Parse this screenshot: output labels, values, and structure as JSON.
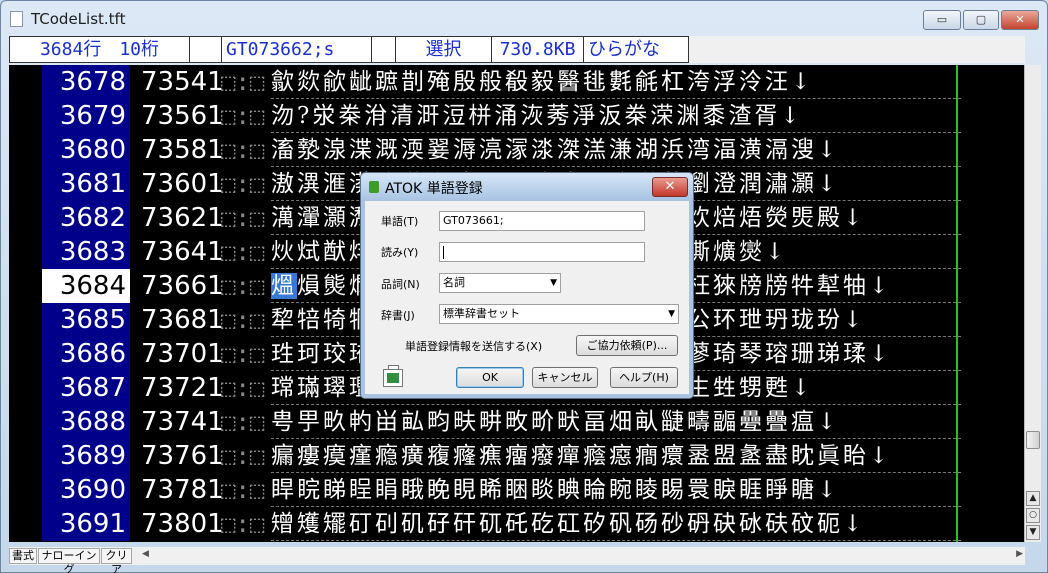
{
  "window": {
    "title": "TCodeList.tft",
    "min_label": "▭",
    "max_label": "▢",
    "close_label": "✕"
  },
  "status": {
    "line": "3684行",
    "column": "10桁",
    "blank1": "",
    "search": "GT073662;s",
    "blank2": "",
    "mode": "選択",
    "size": "730.8KB",
    "input_mode": "ひらがな"
  },
  "rows": [
    {
      "ln": "3678",
      "code": "73541",
      "sep": "⬚:⬚",
      "text": "歙欻歈龇蹠剒殗殷般殽毅醫毴氀毹杠洿浮泠汪↓",
      "current": false
    },
    {
      "ln": "3679",
      "code": "73561",
      "sep": "⬚:⬚",
      "text": "沕?泶桊洕清涆浢栟涌洃莠淨汳桊溁渊黍渣胥↓",
      "current": false
    },
    {
      "ln": "3680",
      "code": "73581",
      "sep": "⬚:⬚",
      "text": "滀漐湶渫溉渜翣溽湸溕渁滐溔溓湖浜湾湢潢滆溲↓",
      "current": false
    },
    {
      "ln": "3681",
      "code": "73601",
      "sep": "⬚:⬚",
      "text": "滶潩滙漭澬滟漷滵滭潈滱滹漻滳潸薄瀏澄潤潚灝↓",
      "current": false
    },
    {
      "ln": "3682",
      "code": "73621",
      "sep": "⬚:⬚",
      "text": "澫瀈灝瀩灁灃灄灊灋灍灎灔灖灙灒炗炊焙焐熒煚殿↓",
      "current": false
    },
    {
      "ln": "3683",
      "code": "73641",
      "sep": "⬚:⬚",
      "text": "炏烒猷炐炾烋烐烓烕烖烗烙焦照燄燉燍爌爕↓",
      "current": false
    },
    {
      "ln": "3684",
      "code": "73661",
      "sep": "⬚:⬚",
      "hl": "熅",
      "text": "熉熋熌熍熎熏熐熑熒熓熔熕熗熘熛枉猍牓牓牪犎牰↓",
      "current": true
    },
    {
      "ln": "3685",
      "code": "73681",
      "sep": "⬚:⬚",
      "text": "犂犃犄犅犆犇犈犉犊犋犌犍犎犏犐犑公环玴玬珑玢↓",
      "current": false
    },
    {
      "ln": "3686",
      "code": "73701",
      "sep": "⬚:⬚",
      "text": "珄珂珓珔珕珖珗珘珚珜珝珞珟珡珢珣蓼琦琴瑢珊珶瑈↓",
      "current": false
    },
    {
      "ln": "3687",
      "code": "73721",
      "sep": "⬚:⬚",
      "text": "瑺璊璻璼璽璾瓀瓁瓂瓃瓄瓅瓆瓇甘甚生甡甥甦↓",
      "current": false
    },
    {
      "ln": "3688",
      "code": "73741",
      "sep": "⬚:⬚",
      "text": "甹甼畂畃畄畆畇畉畊畋畍畎畐畑畒疀疇疈疉疊瘟↓",
      "current": false
    },
    {
      "ln": "3689",
      "code": "73761",
      "sep": "⬚:⬚",
      "text": "瘺瘻瘼瘽瘾癀癁癃癄癅癈癉癊癋癎癏盝盟盠盡眈眞眙↓",
      "current": false
    },
    {
      "ln": "3690",
      "code": "73781",
      "sep": "⬚:⬚",
      "text": "睅睆睇睈睊睋睌睍睎睏睒睓睔睕睖睗睘睙睚睜瞊↓",
      "current": false
    },
    {
      "ln": "3691",
      "code": "73801",
      "sep": "⬚:⬚",
      "text": "矰矱矲矴矵矶矷矸矹矺矻矼矽矾砀砂砃砄砅砆砇砈↓",
      "current": false
    }
  ],
  "bottom": {
    "format": "書式",
    "narrowing": "ナローイング",
    "clear": "クリア"
  },
  "dialog": {
    "title": "ATOK 単語登録",
    "word_label": "単語(T)",
    "word_value": "GT073661;",
    "reading_label": "読み(Y)",
    "reading_value": "",
    "pos_label": "品詞(N)",
    "pos_value": "名詞",
    "dict_label": "辞書(J)",
    "dict_value": "標準辞書セット",
    "send_label": "単語登録情報を送信する(X)",
    "cooperate_label": "ご協力依頼(P)...",
    "ok_label": "OK",
    "cancel_label": "キャンセル",
    "help_label": "ヘルプ(H)"
  }
}
